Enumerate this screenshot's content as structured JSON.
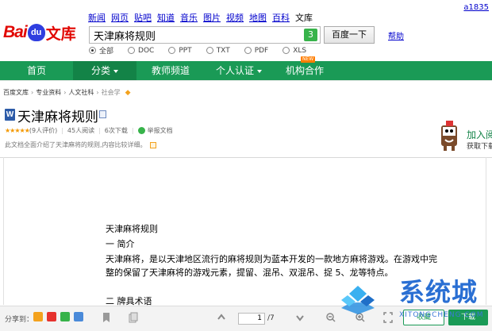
{
  "header": {
    "logo": {
      "part1": "Bai",
      "paw": "du",
      "part2": "文库"
    },
    "nav_links": [
      {
        "label": "新闻",
        "link": true
      },
      {
        "label": "网页",
        "link": true
      },
      {
        "label": "贴吧",
        "link": true
      },
      {
        "label": "知道",
        "link": true
      },
      {
        "label": "音乐",
        "link": true
      },
      {
        "label": "图片",
        "link": true
      },
      {
        "label": "视频",
        "link": true
      },
      {
        "label": "地图",
        "link": true
      },
      {
        "label": "百科",
        "link": true
      },
      {
        "label": "文库",
        "link": false
      }
    ],
    "account": "a1835",
    "search": {
      "value": "天津麻将规则",
      "count": "3",
      "button": "百度一下",
      "help": "帮助"
    },
    "filters": [
      {
        "label": "全部",
        "checked": true
      },
      {
        "label": "DOC",
        "checked": false
      },
      {
        "label": "PPT",
        "checked": false
      },
      {
        "label": "TXT",
        "checked": false
      },
      {
        "label": "PDF",
        "checked": false
      },
      {
        "label": "XLS",
        "checked": false
      }
    ]
  },
  "nav_bar": {
    "items": [
      {
        "label": "首页",
        "caret": false,
        "active": false
      },
      {
        "label": "分类",
        "caret": true,
        "active": true
      },
      {
        "label": "教师频道",
        "caret": false,
        "active": false
      },
      {
        "label": "个人认证",
        "caret": true,
        "active": false
      },
      {
        "label": "机构合作",
        "caret": false,
        "active": false
      }
    ],
    "new_badge": "NEW"
  },
  "breadcrumb": [
    "百度文库",
    "专业资料",
    "人文社科",
    "社会学"
  ],
  "doc": {
    "title": "天津麻将规则",
    "rating_stars": "★★★★★",
    "rating_count": "(9人评价)",
    "reads": "45人阅读",
    "downloads": "6次下载",
    "report": "举报文档",
    "summary": "此文档全面介绍了天津麻将的规则,内容比较详细。"
  },
  "side_promo": {
    "title": "加入阅",
    "subtitle": "获取下载"
  },
  "content": {
    "heading": "天津麻将规则",
    "section1": "一  简介",
    "para1_line1": "天津麻将，是以天津地区流行的麻将规则为蓝本开发的一款地方麻将游戏。在游戏中完",
    "para1_line2": "整的保留了天津麻将的游戏元素，提留、混吊、双混吊、捉 5、龙等特点。",
    "section2": "二  牌具术语"
  },
  "toolbar": {
    "share_label": "分享到：",
    "page_current": "1",
    "page_total": "/7",
    "save": "收藏",
    "download": "下载"
  },
  "watermark": {
    "text": "系统城",
    "url": "XITONGCHENG.COM"
  },
  "colors": {
    "brand_green": "#1a9a56",
    "baidu_red": "#e10601",
    "link_blue": "#0000cc"
  }
}
